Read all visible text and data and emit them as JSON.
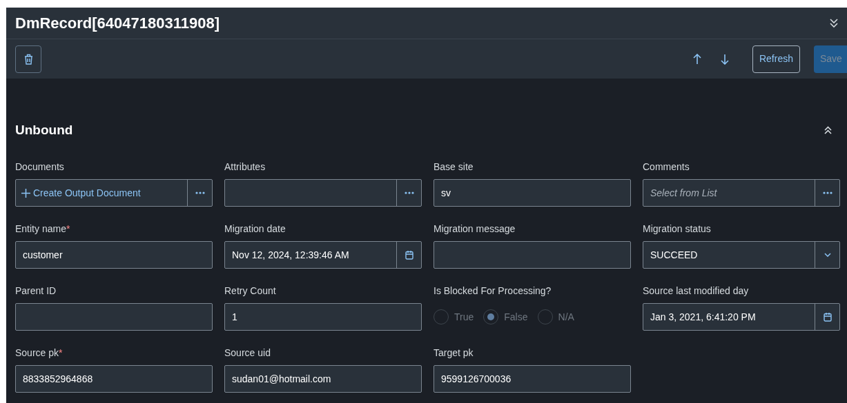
{
  "header": {
    "title": "DmRecord[64047180311908]"
  },
  "toolbar": {
    "refresh": "Refresh",
    "save": {
      "label": "Save",
      "disabled": true
    }
  },
  "section": {
    "title": "Unbound",
    "expanded": true
  },
  "fields": [
    {
      "kind": "link",
      "label": "Documents",
      "value": "Create Output Document"
    },
    {
      "kind": "picker",
      "label": "Attributes"
    },
    {
      "kind": "text",
      "label": "Base site",
      "value": "sv"
    },
    {
      "kind": "picker",
      "label": "Comments",
      "placeholder": "Select from List"
    },
    {
      "kind": "text",
      "label": "Entity name",
      "required_mark": "*",
      "value": "customer"
    },
    {
      "kind": "date",
      "label": "Migration date",
      "value": "Nov 12, 2024, 12:39:46 AM"
    },
    {
      "kind": "text",
      "label": "Migration message"
    },
    {
      "kind": "select",
      "label": "Migration status",
      "value": "SUCCEED"
    },
    {
      "kind": "text",
      "label": "Parent ID"
    },
    {
      "kind": "text",
      "label": "Retry Count",
      "value": "1"
    },
    {
      "kind": "radio",
      "label": "Is Blocked For Processing?",
      "options": [
        {
          "label": "True",
          "selected": false
        },
        {
          "label": "False",
          "selected": true
        },
        {
          "label": "N/A",
          "selected": false
        }
      ]
    },
    {
      "kind": "date",
      "label": "Source last modified day",
      "value": "Jan 3, 2021, 6:41:20 PM"
    },
    {
      "kind": "text",
      "label": "Source pk",
      "required_mark": "*",
      "value": "8833852964868"
    },
    {
      "kind": "text",
      "label": "Source uid",
      "value": "sudan01@hotmail.com"
    },
    {
      "kind": "text",
      "label": "Target pk",
      "value": "9599126700036"
    }
  ]
}
